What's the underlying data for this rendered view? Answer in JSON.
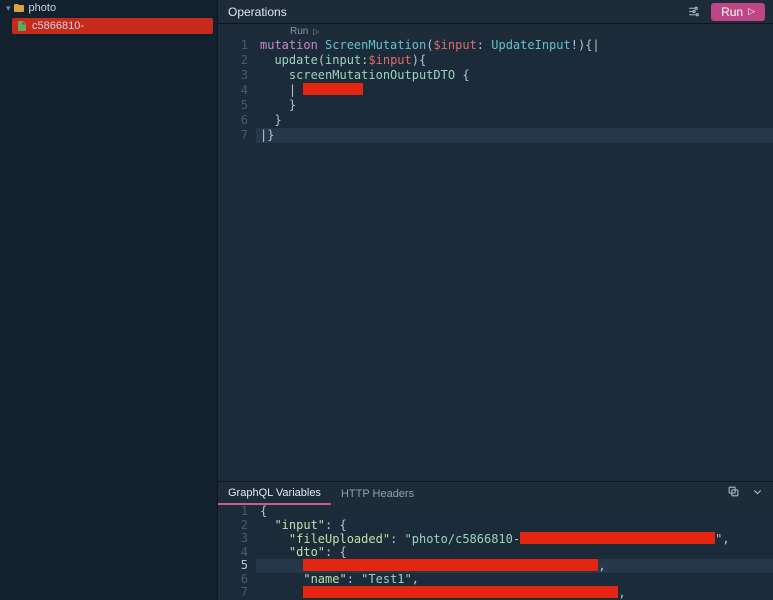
{
  "sidebar": {
    "folder": {
      "name": "photo"
    },
    "file": {
      "name": "c5866810-"
    }
  },
  "operations": {
    "title": "Operations",
    "runLinkLabel": "Run ",
    "runButtonLabel": "Run",
    "lineNumbers": [
      "1",
      "2",
      "3",
      "4",
      "5",
      "6",
      "7"
    ],
    "code": {
      "kw_mutation": "mutation",
      "name": "ScreenMutation",
      "varInput": "$input",
      "typeInput": "UpdateInput",
      "bang": "!",
      "field_update": "update",
      "arg_input": "input",
      "field_dto": "screenMutationOutputDTO",
      "openParen": "(",
      "closeParen": ")",
      "colon": ":",
      "space": " ",
      "obr": "{",
      "cbr": "}",
      "dbOpen": "{|",
      "dbClose": "|}",
      "pipe": "| "
    }
  },
  "variables": {
    "tabs": {
      "vars": "GraphQL Variables",
      "headers": "HTTP Headers"
    },
    "lineNumbers": [
      "1",
      "2",
      "3",
      "4",
      "5",
      "6",
      "7"
    ],
    "tokens": {
      "obr": "{",
      "key_input": "\"input\"",
      "key_fileUploaded": "\"fileUploaded\"",
      "val_file_prefix": "\"photo/c5866810-",
      "key_dto": "\"dto\"",
      "key_name": "\"name\"",
      "val_name": "\"Test1\"",
      "colon": ": ",
      "comma": ",",
      "quote_comma": "\","
    }
  }
}
